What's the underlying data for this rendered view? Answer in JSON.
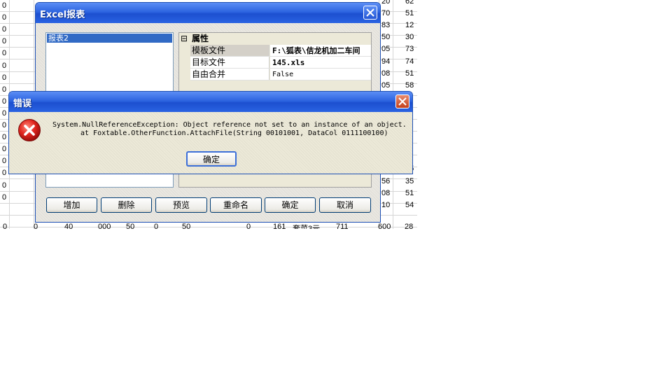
{
  "sheet": {
    "left_col": [
      "0",
      "0",
      "0",
      "0",
      "0",
      "0",
      "0",
      "0",
      "0",
      "0",
      "0",
      "0",
      "0",
      "0",
      "0",
      "0",
      "0"
    ],
    "right_col_a": [
      "20",
      "70",
      "83",
      "50",
      "05",
      "94",
      "08",
      "05",
      "",
      "",
      "",
      "",
      "",
      "",
      "12",
      "56",
      "08",
      "10"
    ],
    "right_col_b": [
      "62",
      "51",
      "12",
      "30",
      "73",
      "74",
      "51",
      "58",
      "",
      "",
      "",
      "",
      "",
      "",
      "65",
      "35",
      "51",
      "54"
    ],
    "bottom_row": [
      "0",
      "0",
      "40",
      "000",
      "50",
      "0",
      "50",
      "0",
      "161",
      "套菜3元",
      "711",
      "600",
      "28"
    ]
  },
  "excel_dialog": {
    "title": "Excel报表",
    "list_items": [
      "报表2"
    ],
    "properties_header": "属性",
    "collapse_glyph": "⊟",
    "properties": [
      {
        "name": "模板文件",
        "value": "F:\\狐表\\佶龙机加二车间",
        "bold": true
      },
      {
        "name": "目标文件",
        "value": "145.xls",
        "bold": true
      },
      {
        "name": "自由合并",
        "value": "False",
        "bold": false
      }
    ],
    "buttons": [
      "增加",
      "删除",
      "预览",
      "重命名",
      "确定",
      "取消"
    ]
  },
  "error_dialog": {
    "title": "错误",
    "message_line1": "System.NullReferenceException: Object reference not set to an instance of an object.",
    "message_line2": "at Foxtable.OtherFunction.AttachFile(String 00101001, DataCol 0111100100)",
    "ok_label": "确定"
  },
  "colors": {
    "title_blue": "#2d64e0",
    "close_red": "#c4401a",
    "error_icon_red": "#d8211f",
    "selection_blue": "#316ac5"
  },
  "icons": {
    "error": "error-x-icon",
    "close": "close-icon"
  }
}
